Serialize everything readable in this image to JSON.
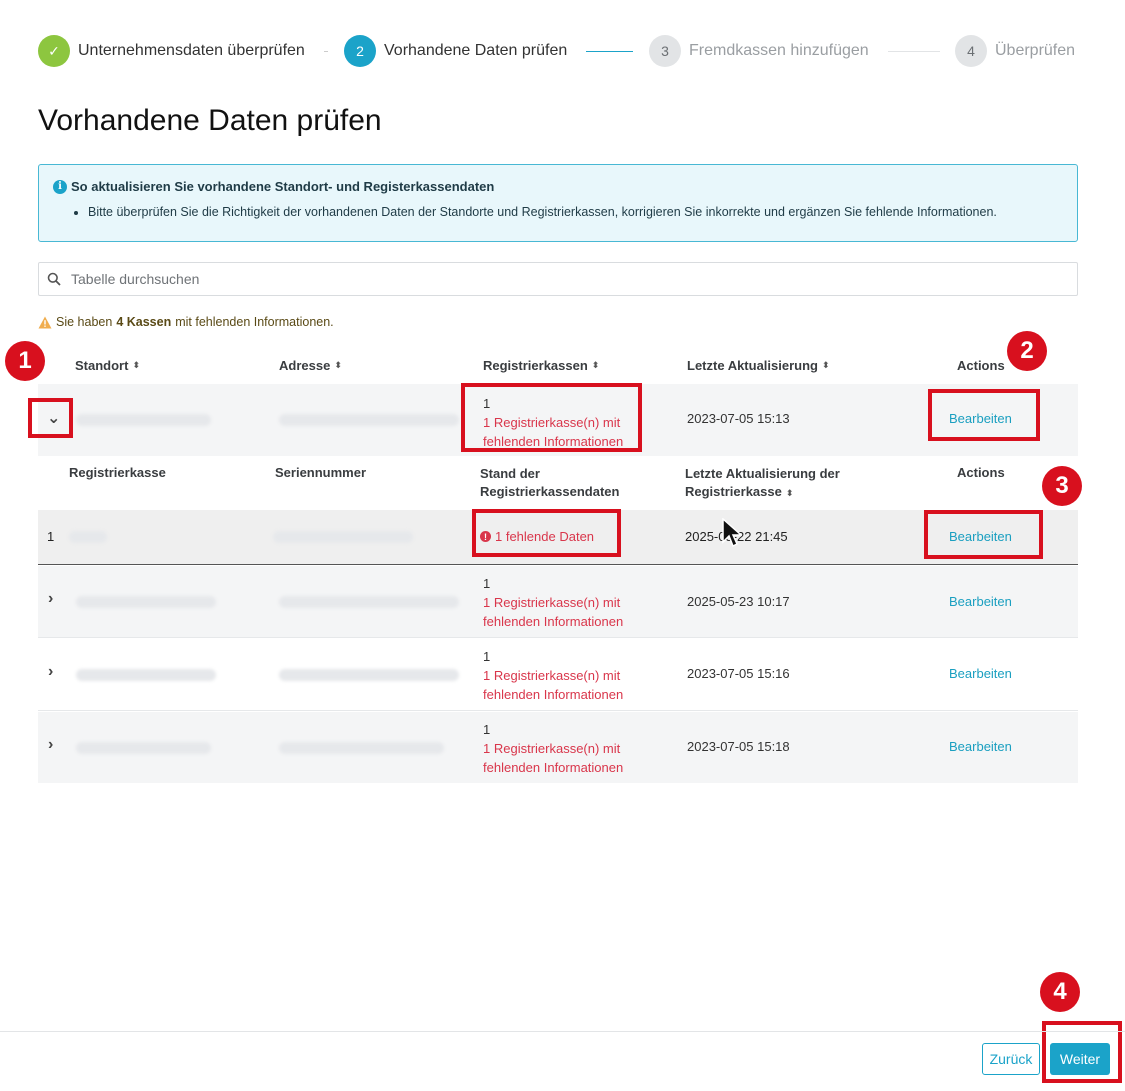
{
  "stepper": {
    "steps": [
      {
        "number": "✓",
        "label": "Unternehmensdaten überprüfen",
        "state": "done"
      },
      {
        "number": "2",
        "label": "Vorhandene Daten prüfen",
        "state": "active"
      },
      {
        "number": "3",
        "label": "Fremdkassen hinzufügen",
        "state": "pending"
      },
      {
        "number": "4",
        "label": "Überprüfen",
        "state": "pending"
      }
    ]
  },
  "page_title": "Vorhandene Daten prüfen",
  "info": {
    "title": "So aktualisieren Sie vorhandene Standort- und Registerkassendaten",
    "bullet": "Bitte überprüfen Sie die Richtigkeit der vorhandenen Daten der Standorte und Registrierkassen, korrigieren Sie inkorrekte und ergänzen Sie fehlende Informationen."
  },
  "search": {
    "placeholder": "Tabelle durchsuchen"
  },
  "warning": {
    "prefix": "Sie haben",
    "count": "4 Kassen",
    "suffix": "mit fehlenden Informationen."
  },
  "table": {
    "headers": {
      "standort": "Standort",
      "adresse": "Adresse",
      "registrierkassen": "Registrierkassen",
      "letzte": "Letzte Aktualisierung",
      "actions": "Actions"
    },
    "rows": [
      {
        "count": "1",
        "missing_1": "1 Registrierkasse(n) mit",
        "missing_2": "fehlenden Informationen",
        "updated": "2023-07-05 15:13",
        "action": "Bearbeiten"
      },
      {
        "count": "1",
        "missing_1": "1 Registrierkasse(n) mit",
        "missing_2": "fehlenden Informationen",
        "updated": "2025-05-23 10:17",
        "action": "Bearbeiten"
      },
      {
        "count": "1",
        "missing_1": "1 Registrierkasse(n) mit",
        "missing_2": "fehlenden Informationen",
        "updated": "2023-07-05 15:16",
        "action": "Bearbeiten"
      },
      {
        "count": "1",
        "missing_1": "1 Registrierkasse(n) mit",
        "missing_2": "fehlenden Informationen",
        "updated": "2023-07-05 15:18",
        "action": "Bearbeiten"
      }
    ]
  },
  "subtable": {
    "headers": {
      "registrierkasse": "Registrierkasse",
      "seriennummer": "Seriennummer",
      "stand_1": "Stand der",
      "stand_2": "Registrierkassendaten",
      "letzte_1": "Letzte Aktualisierung der",
      "letzte_2": "Registrierkasse",
      "actions": "Actions"
    },
    "row": {
      "index": "1",
      "status": "1 fehlende Daten",
      "updated": "2025-05-22 21:45",
      "action": "Bearbeiten"
    }
  },
  "badges": [
    "1",
    "2",
    "3",
    "4"
  ],
  "footer": {
    "back": "Zurück",
    "next": "Weiter"
  },
  "colors": {
    "accent": "#1ba3c9",
    "done": "#8dc63f",
    "error": "#d9364b",
    "annotation": "#d8101e"
  }
}
